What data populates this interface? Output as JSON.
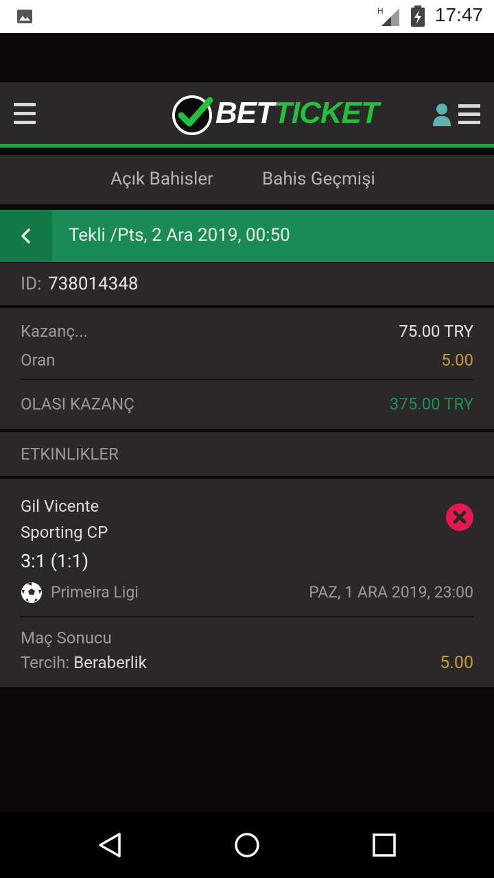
{
  "status_bar": {
    "time": "17:47",
    "network": "H"
  },
  "app": {
    "logo_bet": "BET",
    "logo_ticket": "TICKET"
  },
  "tabs": [
    {
      "label": "Açık Bahisler"
    },
    {
      "label": "Bahis Geçmişi"
    }
  ],
  "bet": {
    "title": "Tekli /Pts, 2 Ara 2019, 00:50",
    "id_label": "ID:",
    "id_value": "738014348",
    "stake_label": "Kazanç...",
    "stake_value": "75.00 TRY",
    "odds_label": "Oran",
    "odds_value": "5.00",
    "potential_label": "OLASI KAZANÇ",
    "potential_value": "375.00 TRY"
  },
  "events_header": "ETKINLIKLER",
  "event": {
    "home": "Gil Vicente",
    "away": "Sporting CP",
    "score": "3:1 (1:1)",
    "league": "Primeira Ligi",
    "datetime": "PAZ, 1 ARA 2019, 23:00",
    "market": "Maç Sonucu",
    "pick_label": "Tercih:",
    "pick_value": "Beraberlik",
    "pick_odds": "5.00",
    "status_icon": "lost-x-icon"
  },
  "colors": {
    "brand_green": "#23c13a",
    "title_bar": "#1a8a56",
    "odds_gold": "#c99a38",
    "potential_green": "#1e8e55",
    "lost_red": "#e5184f"
  }
}
